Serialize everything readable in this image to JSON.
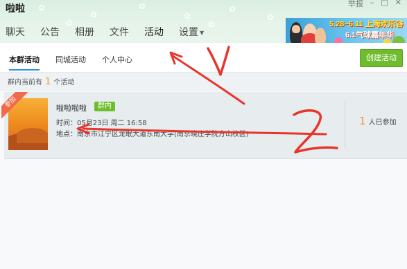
{
  "window": {
    "title": "啦啦",
    "controls": [
      "举报",
      "–",
      "□",
      "✕"
    ]
  },
  "tabs": [
    {
      "label": "聊天",
      "active": false
    },
    {
      "label": "公告",
      "active": false
    },
    {
      "label": "相册",
      "active": false
    },
    {
      "label": "文件",
      "active": false
    },
    {
      "label": "活动",
      "active": true
    },
    {
      "label": "设置",
      "active": false,
      "has_dropdown": true
    }
  ],
  "ad": {
    "line1": "5.28~6.11 上海欢乐谷",
    "line2": "6.1气球嘉年华"
  },
  "subnav": {
    "items": [
      {
        "label": "本群活动",
        "active": true
      },
      {
        "label": "同城活动",
        "active": false
      },
      {
        "label": "个人中心",
        "active": false
      }
    ],
    "create_button": "创建活动"
  },
  "summary": {
    "prefix": "群内当前有",
    "count": "1",
    "suffix": "个活动"
  },
  "activity": {
    "ribbon": "参加",
    "title": "啦啦啦啦",
    "badge": "群内",
    "time": "时间：05月23日 周二 16:58",
    "place": "地点：南京市江宁区龙眠大道东南大学(南京晓庄学院方山校区)",
    "joined_count": "1",
    "joined_suffix": "人已参加"
  },
  "annotations": {
    "stroke_color": "#e8342b",
    "numbers": [
      "1",
      "2"
    ]
  }
}
